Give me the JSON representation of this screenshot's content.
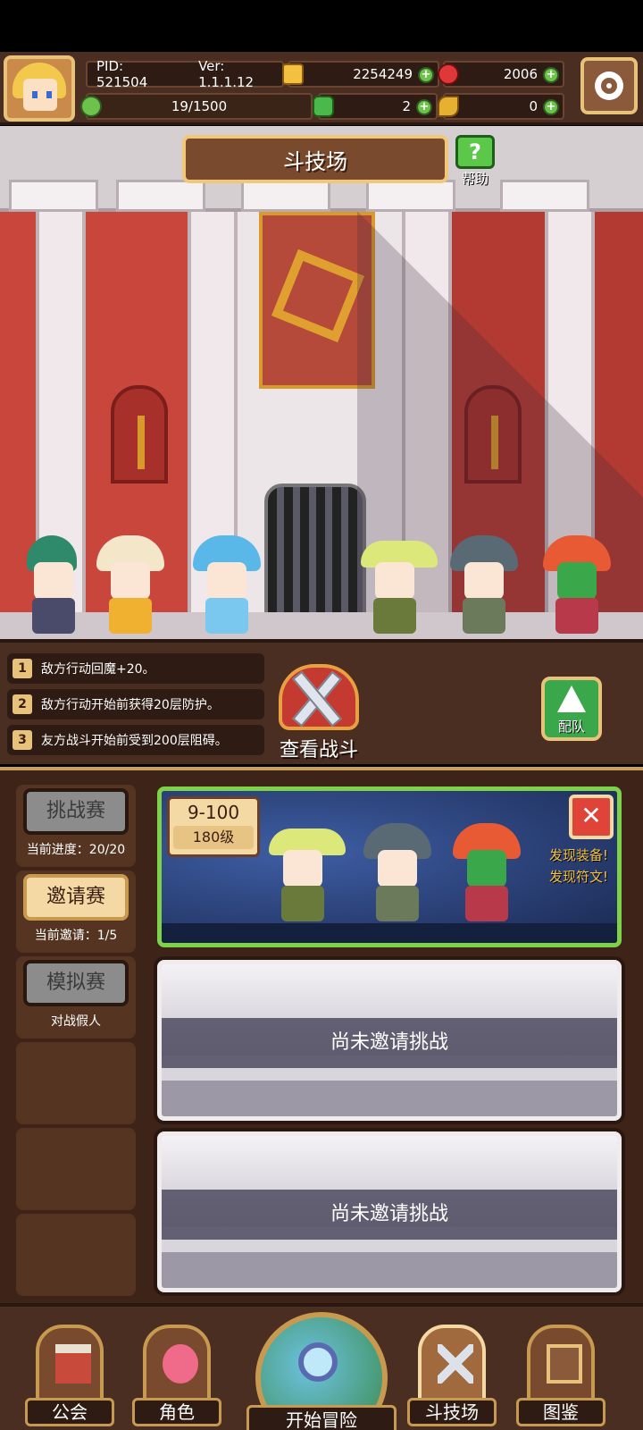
{
  "topbar": {
    "pid": "PID: 521504",
    "version": "Ver: 1.1.1.12",
    "gold": "2254249",
    "ruby": "2006",
    "stamina": "19/1500",
    "clover": "2",
    "key": "0"
  },
  "arena": {
    "title": "斗技场",
    "help_label": "帮助"
  },
  "modifiers": [
    {
      "num": "1",
      "text": "敌方行动回魔+20。"
    },
    {
      "num": "2",
      "text": "敌方行动开始前获得20层防护。"
    },
    {
      "num": "3",
      "text": "友方战斗开始前受到200层阻碍。"
    }
  ],
  "view_fight_label": "查看战斗",
  "team_label": "配队",
  "sidebar": {
    "challenge": {
      "label": "挑战赛",
      "info": "当前进度：20/20"
    },
    "invite": {
      "label": "邀请赛",
      "info": "当前邀请：1/5"
    },
    "simulate": {
      "label": "模拟赛",
      "info": "对战假人"
    }
  },
  "active_card": {
    "stage": "9-100",
    "level": "180级",
    "discover_gear": "发现装备!",
    "discover_rune": "发现符文!"
  },
  "empty_cards": [
    {
      "text": "尚未邀请挑战"
    },
    {
      "text": "尚未邀请挑战"
    }
  ],
  "nav": {
    "guild": "公会",
    "character": "角色",
    "adventure": "开始冒险",
    "arena": "斗技场",
    "codex": "图鉴"
  },
  "colors": {
    "panel_brown": "#4a2e22",
    "gold_border": "#e8c27a",
    "active_green": "#7ed24a",
    "close_red": "#e04438"
  }
}
